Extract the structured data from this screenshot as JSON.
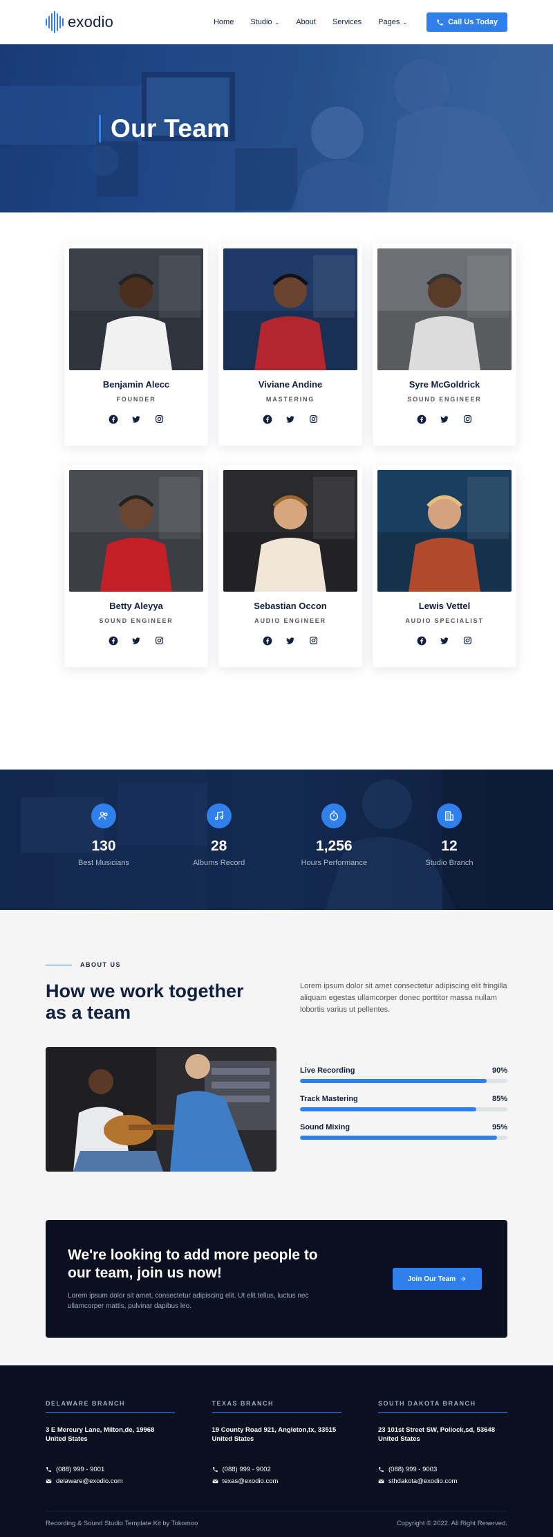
{
  "brand": {
    "name": "exodio"
  },
  "nav": {
    "items": [
      {
        "label": "Home",
        "dropdown": false
      },
      {
        "label": "Studio",
        "dropdown": true
      },
      {
        "label": "About",
        "dropdown": false
      },
      {
        "label": "Services",
        "dropdown": false
      },
      {
        "label": "Pages",
        "dropdown": true
      }
    ],
    "cta_label": "Call Us Today"
  },
  "hero": {
    "title": "Our Team"
  },
  "team": {
    "members": [
      {
        "name": "Benjamin Alecc",
        "role": "FOUNDER"
      },
      {
        "name": "Viviane Andine",
        "role": "MASTERING"
      },
      {
        "name": "Syre McGoldrick",
        "role": "SOUND ENGINEER"
      },
      {
        "name": "Betty Aleyya",
        "role": "SOUND ENGINEER"
      },
      {
        "name": "Sebastian Occon",
        "role": "AUDIO ENGINEER"
      },
      {
        "name": "Lewis Vettel",
        "role": "AUDIO SPECIALIST"
      }
    ]
  },
  "stats": [
    {
      "value": "130",
      "label": "Best Musicians",
      "icon": "musicians-icon"
    },
    {
      "value": "28",
      "label": "Albums Record",
      "icon": "music-note-icon"
    },
    {
      "value": "1,256",
      "label": "Hours Performance",
      "icon": "stopwatch-icon"
    },
    {
      "value": "12",
      "label": "Studio Branch",
      "icon": "building-icon"
    }
  ],
  "about": {
    "eyebrow": "ABOUT US",
    "heading": "How we work together as a team",
    "text": "Lorem ipsum dolor sit amet consectetur adipiscing elit fringilla aliquam egestas ullamcorper donec porttitor massa nullam lobortis varius ut pellentes.",
    "skills": [
      {
        "label": "Live Recording",
        "percent_label": "90%",
        "value": 90
      },
      {
        "label": "Track Mastering",
        "percent_label": "85%",
        "value": 85
      },
      {
        "label": "Sound Mixing",
        "percent_label": "95%",
        "value": 95
      }
    ]
  },
  "join": {
    "heading": "We're looking to add more people to our team, join us now!",
    "text": "Lorem ipsum dolor sit amet, consectetur adipiscing elit. Ut elit tellus, luctus nec ullamcorper mattis, pulvinar dapibus leo.",
    "button_label": "Join Our Team"
  },
  "footer": {
    "branches": [
      {
        "title": "DELAWARE BRANCH",
        "address": "3 E Mercury Lane, Milton,de, 19968 United States",
        "phone": "(088) 999 - 9001",
        "email": "delaware@exodio.com"
      },
      {
        "title": "TEXAS BRANCH",
        "address": "19 County Road 921, Angleton,tx, 33515 United States",
        "phone": "(088) 999 - 9002",
        "email": "texas@exodio.com"
      },
      {
        "title": "SOUTH DAKOTA BRANCH",
        "address": "23 101st Street SW, Pollock,sd, 53648 United States",
        "phone": "(088) 999 - 9003",
        "email": "sthdakota@exodio.com"
      }
    ],
    "credit": "Recording & Sound Studio Template Kit by Tokomoo",
    "copyright": "Copyright © 2022. All Right Reserved."
  },
  "colors": {
    "accent": "#2f80ed",
    "navy": "#12203f",
    "dark": "#0b1020"
  }
}
